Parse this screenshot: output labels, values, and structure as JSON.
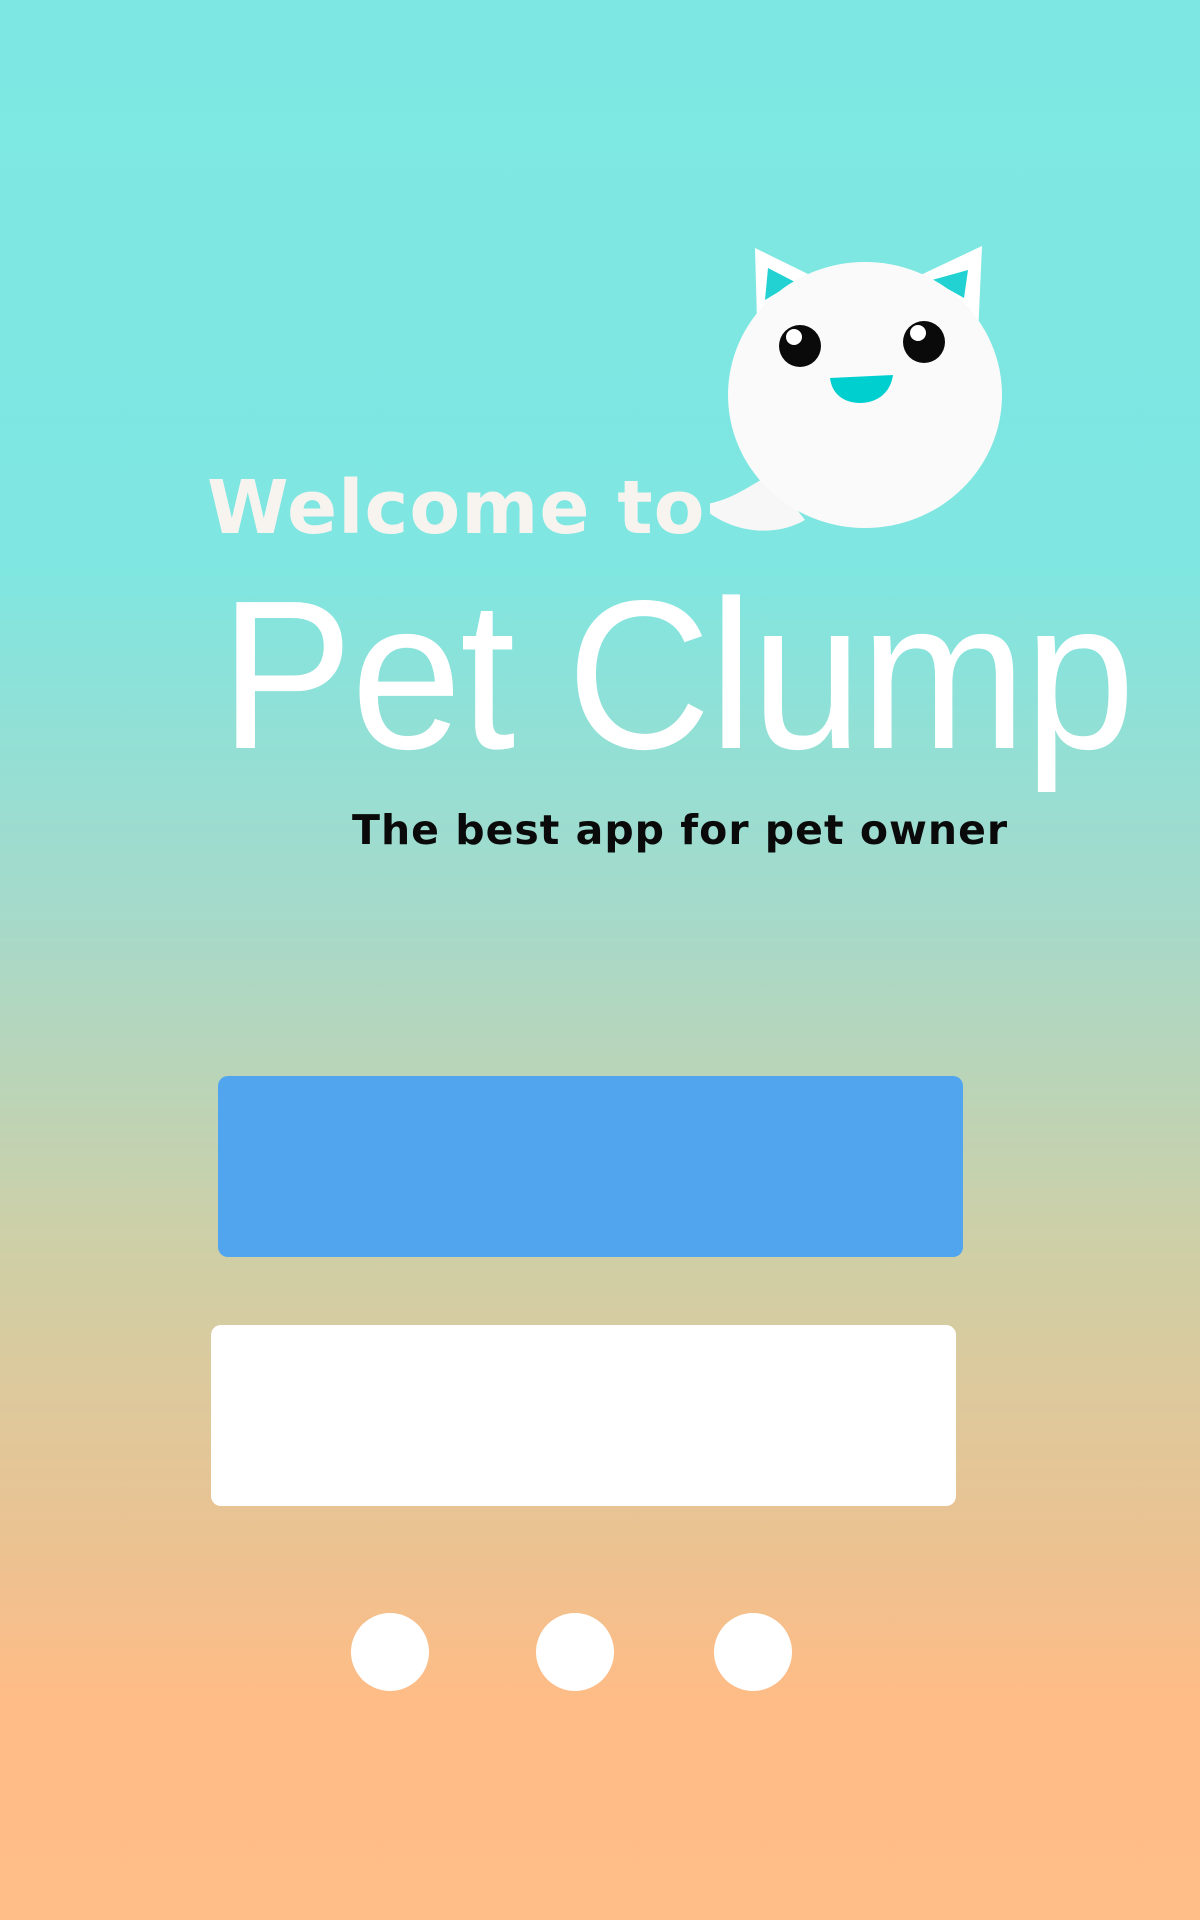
{
  "splash": {
    "welcome": "Welcome to",
    "app_name": "Pet Clump",
    "tagline": "The best app for pet owner"
  },
  "actions": {
    "primary_label": "",
    "secondary_label": ""
  },
  "pager": {
    "count": 3
  },
  "icons": {
    "mascot": "cat-speech-bubble-icon"
  },
  "colors": {
    "background_top": "#7de8e3",
    "background_bottom": "#ffbd87",
    "primary_button": "#51a5ef",
    "secondary_button": "#ffffff",
    "mascot_accent": "#00cfd0",
    "text_light": "#ffffff",
    "text_dark": "#0a0a0a"
  }
}
